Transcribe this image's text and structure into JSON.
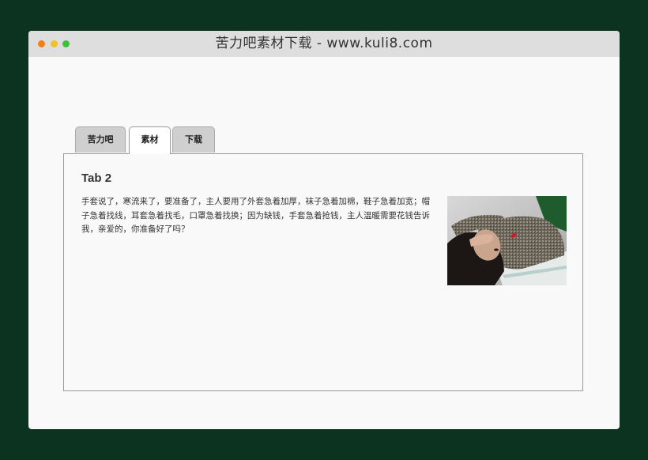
{
  "window": {
    "title": "苦力吧素材下载 - www.kuli8.com"
  },
  "tabs": [
    {
      "label": "苦力吧",
      "active": false
    },
    {
      "label": "素材",
      "active": true
    },
    {
      "label": "下载",
      "active": false
    }
  ],
  "panel": {
    "heading": "Tab 2",
    "text": "手套说了，寒流来了，要准备了，主人要用了外套急着加厚，袜子急着加棉，鞋子急着加宽；帽子急着找线，耳套急着找毛，口罩急着找换；因为缺钱，手套急着抢钱，主人温暖需要花钱告诉我，亲爱的，你准备好了吗？",
    "image": "woman-lying-on-table-photo"
  },
  "colors": {
    "background": "#0b3320",
    "titlebar": "#dedede",
    "dot_red": "#f47f14",
    "dot_yellow": "#f3c12b",
    "dot_green": "#3fc03a"
  }
}
